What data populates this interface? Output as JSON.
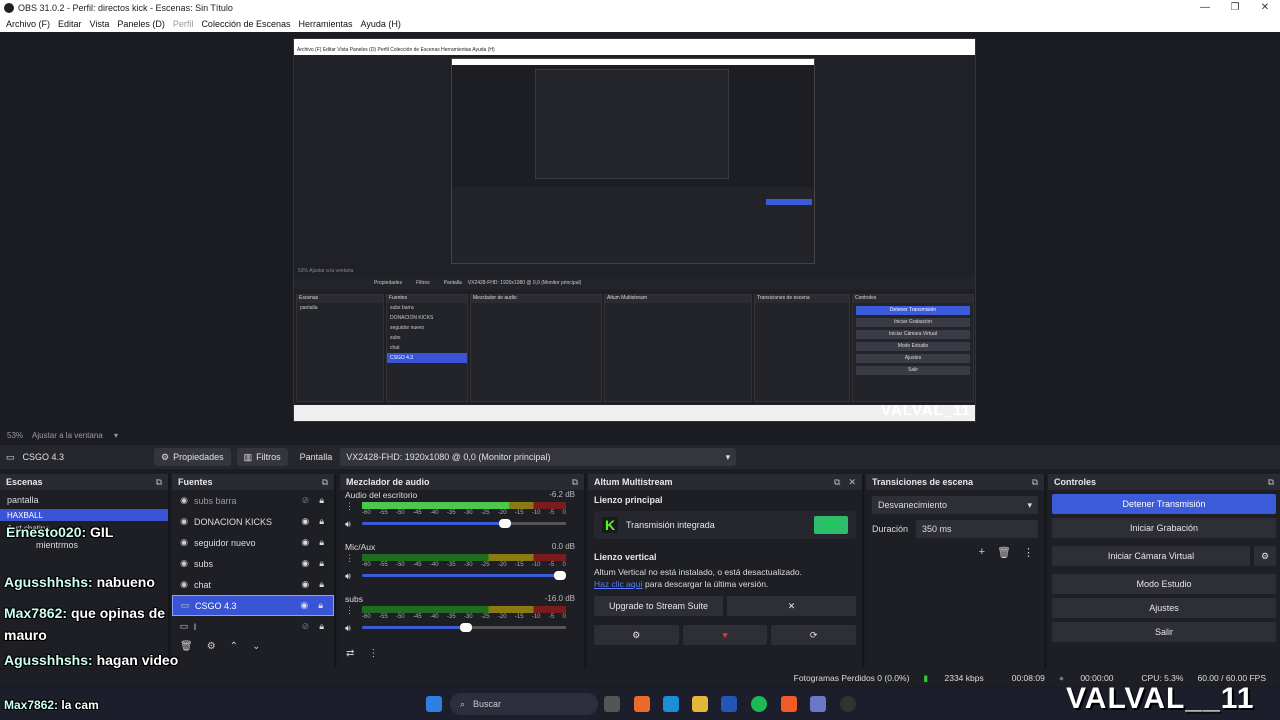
{
  "window": {
    "title": "OBS 31.0.2 - Perfil: directos kick - Escenas: Sin Título",
    "controls": [
      "—",
      "❐",
      "✕"
    ]
  },
  "menu": [
    "Archivo (F)",
    "Editar",
    "Vista",
    "Paneles (D)",
    "Perfil",
    "Colección de Escenas",
    "Herramientas",
    "Ayuda (H)"
  ],
  "preview": {
    "menu_text": "Archivo (F)   Editar   Vista   Paneles (D)   Perfil   Colección de Escenas   Herramientas   Ayuda (H)",
    "zoom_text": "53%   Ajustar a la ventana",
    "bar": {
      "properties": "Propiedades",
      "filters": "Filtros",
      "source": "Pantalla",
      "device": "VX2428-FHD: 1920x1080 @ 0,0 (Monitor principal)"
    },
    "docks": {
      "scenes": "Escenas",
      "sources": "Fuentes",
      "mixer": "Mezclador de audio",
      "multistream": "Altum Multistream",
      "transitions": "Transiciones de escena",
      "controls": "Controles"
    },
    "scenes": [
      "pantalla"
    ],
    "sources": [
      "subs barra",
      "DONACION KICKS",
      "seguidor nuevo",
      "subs",
      "chat",
      "CSGO 4.3"
    ],
    "controls": [
      "Detener Transmisión",
      "Iniciar Grabación",
      "Iniciar Cámara Virtual",
      "Modo Estudio",
      "Ajustes",
      "Salir"
    ],
    "logo": "VALVAL_11"
  },
  "zoom": {
    "percent": "53%",
    "fit": "Ajustar a la ventana"
  },
  "context": {
    "scene_name": "CSGO 4.3",
    "properties": "Propiedades",
    "filters": "Filtros",
    "source_label": "Pantalla",
    "device": "VX2428-FHD: 1920x1080 @ 0,0 (Monitor principal)"
  },
  "scenes_dock": {
    "title": "Escenas",
    "items": [
      "pantalla",
      "HAXBALL",
      "Just chating",
      "mientrmos"
    ]
  },
  "sources_dock": {
    "title": "Fuentes",
    "items": [
      {
        "name": "subs barra",
        "visible": false
      },
      {
        "name": "DONACION KICKS",
        "visible": true
      },
      {
        "name": "seguidor nuevo",
        "visible": true
      },
      {
        "name": "subs",
        "visible": true
      },
      {
        "name": "chat",
        "visible": true
      },
      {
        "name": "CSGO 4.3",
        "visible": true,
        "selected": true
      },
      {
        "name": "l",
        "visible": false
      }
    ]
  },
  "mixer_dock": {
    "title": "Mezclador de audio",
    "ticks": [
      "-60",
      "-55",
      "-50",
      "-45",
      "-40",
      "-35",
      "-30",
      "-25",
      "-20",
      "-15",
      "-10",
      "-5",
      "0"
    ],
    "channels": [
      {
        "name": "Audio del escritorio",
        "db": "-6.2 dB",
        "level": 0.72,
        "volume": 0.73
      },
      {
        "name": "Mic/Aux",
        "db": "0.0 dB",
        "level": 0.0,
        "volume": 1.0
      },
      {
        "name": "subs",
        "db": "-16.0 dB",
        "level": 0.0,
        "volume": 0.54
      }
    ]
  },
  "multistream_dock": {
    "title": "Altum Multistream",
    "main_label": "Lienzo principal",
    "integrated": "Transmisión integrada",
    "vertical_label": "Lienzo vertical",
    "warning": "Altum Vertical no está instalado, o está desactualizado.",
    "link": "Haz clic aquí",
    "link_suffix": "para descargar la última versión.",
    "upgrade": "Upgrade to Stream Suite",
    "close": "✕"
  },
  "transitions_dock": {
    "title": "Transiciones de escena",
    "transition": "Desvanecimiento",
    "duration_label": "Duración",
    "duration": "350 ms"
  },
  "controls_dock": {
    "title": "Controles",
    "buttons": [
      "Detener Transmisión",
      "Iniciar Grabación",
      "Iniciar Cámara Virtual",
      "Modo Estudio",
      "Ajustes",
      "Salir"
    ]
  },
  "status": {
    "dropped": "Fotogramas Perdidos 0 (0.0%)",
    "bitrate": "2334 kbps",
    "stream_time": "00:08:09",
    "rec_time": "00:00:00",
    "cpu": "CPU: 5.3%",
    "fps": "60.00 / 60.00 FPS"
  },
  "taskbar": {
    "search": "Buscar"
  },
  "overlay": {
    "chat": [
      {
        "user": "Ernesto020:",
        "msg": "GIL"
      },
      {
        "user": "Agusshhshs:",
        "msg": "nabueno"
      },
      {
        "user": "Max7862:",
        "msg": "que opinas de mauro"
      },
      {
        "user": "Agusshhshs:",
        "msg": "hagan video"
      },
      {
        "user": "Max7862:",
        "msg": "la cam"
      }
    ],
    "logo": "VALVAL__11"
  }
}
